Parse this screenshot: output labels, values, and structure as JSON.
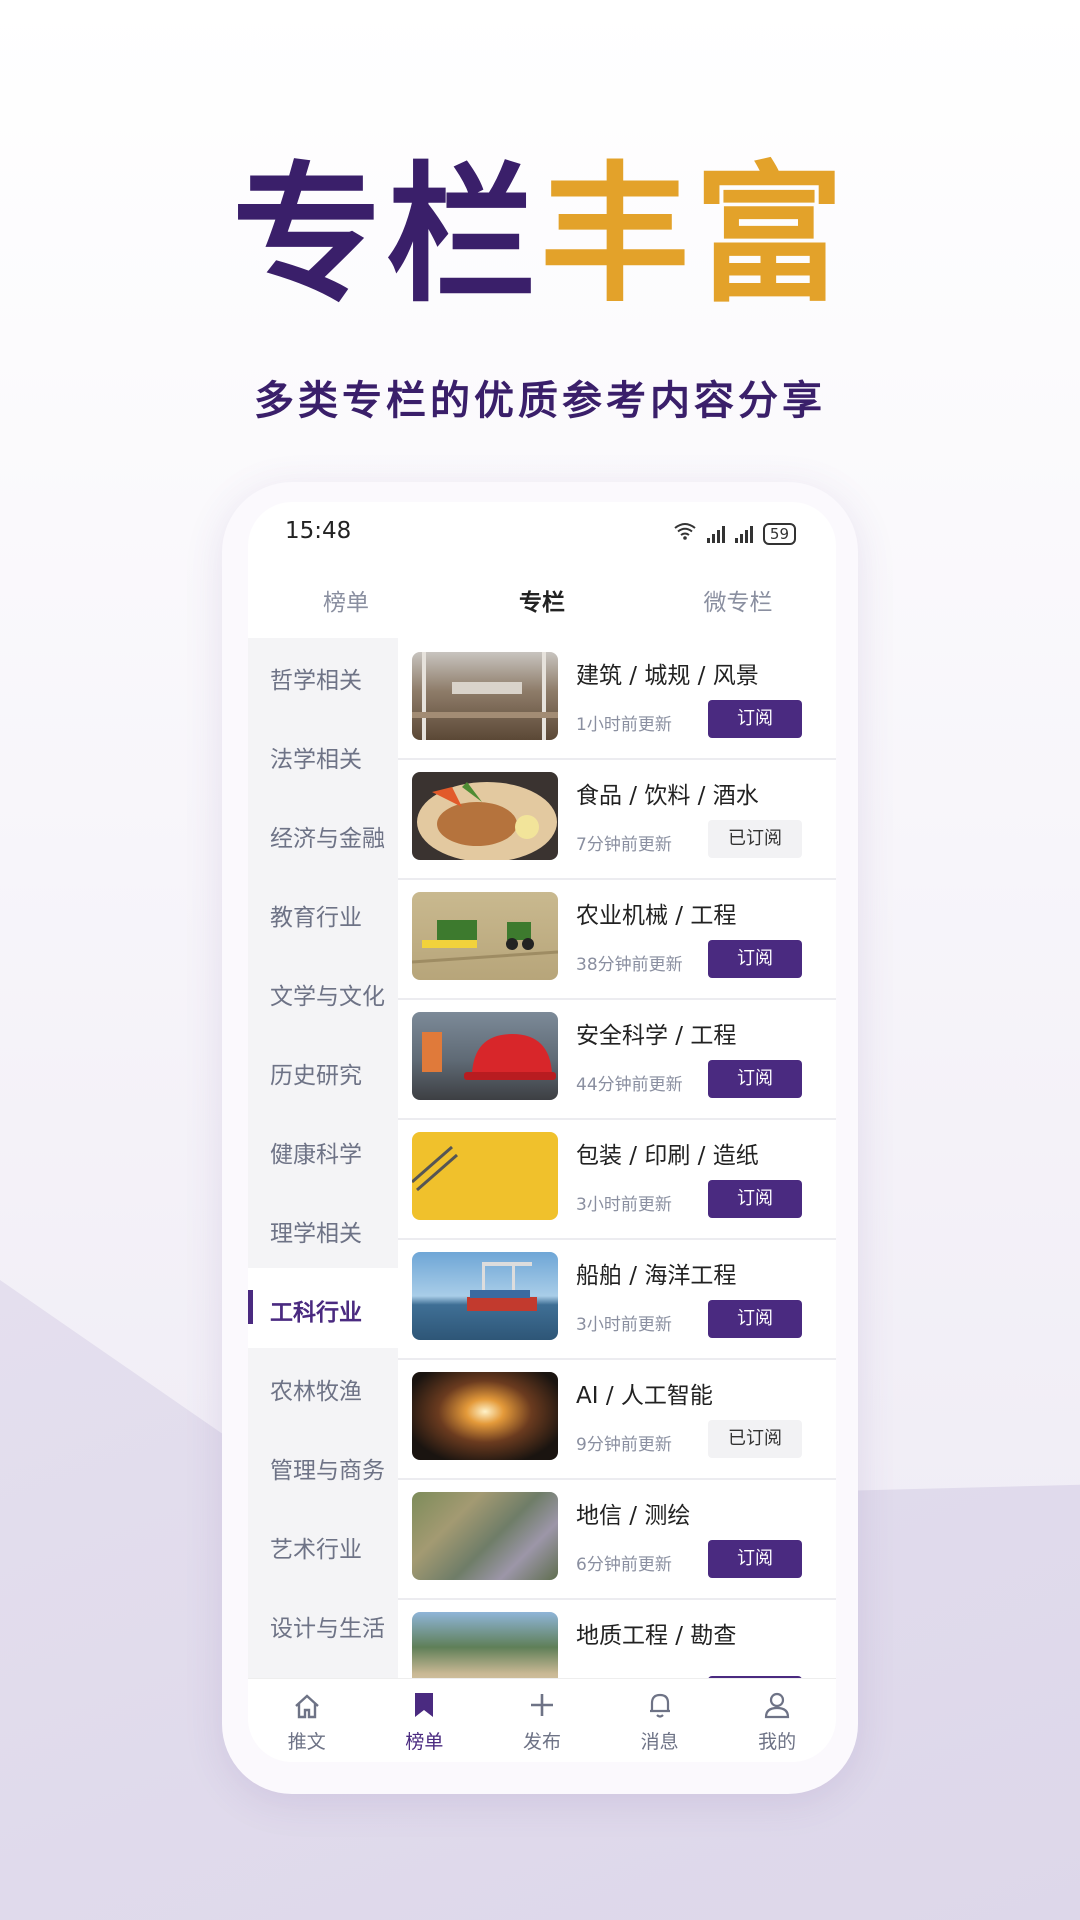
{
  "hero": {
    "title_part1": "专栏",
    "title_part2": "丰富",
    "subtitle": "多类专栏的优质参考内容分享"
  },
  "status": {
    "time": "15:48",
    "battery": "59"
  },
  "tabs": [
    {
      "label": "榜单"
    },
    {
      "label": "专栏",
      "active": true
    },
    {
      "label": "微专栏"
    }
  ],
  "categories": [
    {
      "label": "哲学相关"
    },
    {
      "label": "法学相关"
    },
    {
      "label": "经济与金融"
    },
    {
      "label": "教育行业"
    },
    {
      "label": "文学与文化"
    },
    {
      "label": "历史研究"
    },
    {
      "label": "健康科学"
    },
    {
      "label": "理学相关"
    },
    {
      "label": "工科行业",
      "active": true
    },
    {
      "label": "农林牧渔"
    },
    {
      "label": "管理与商务"
    },
    {
      "label": "艺术行业"
    },
    {
      "label": "设计与生活"
    }
  ],
  "items": [
    {
      "title": "建筑 / 城规 / 风景",
      "time": "1小时前更新",
      "button": "订阅",
      "subscribed": false,
      "thumb": "architecture"
    },
    {
      "title": "食品 / 饮料 / 酒水",
      "time": "7分钟前更新",
      "button": "已订阅",
      "subscribed": true,
      "thumb": "food"
    },
    {
      "title": "农业机械 / 工程",
      "time": "38分钟前更新",
      "button": "订阅",
      "subscribed": false,
      "thumb": "harvester"
    },
    {
      "title": "安全科学 / 工程",
      "time": "44分钟前更新",
      "button": "订阅",
      "subscribed": false,
      "thumb": "helmet"
    },
    {
      "title": "包装 / 印刷 / 造纸",
      "time": "3小时前更新",
      "button": "订阅",
      "subscribed": false,
      "thumb": "yellow-paper"
    },
    {
      "title": "船舶 / 海洋工程",
      "time": "3小时前更新",
      "button": "订阅",
      "subscribed": false,
      "thumb": "ship"
    },
    {
      "title": "AI / 人工智能",
      "time": "9分钟前更新",
      "button": "已订阅",
      "subscribed": true,
      "thumb": "ai-tunnel"
    },
    {
      "title": "地信 / 测绘",
      "time": "6分钟前更新",
      "button": "订阅",
      "subscribed": false,
      "thumb": "satellite-map"
    },
    {
      "title": "地质工程 / 勘查",
      "time": "",
      "button": "",
      "subscribed": false,
      "thumb": "coast"
    }
  ],
  "bottom_nav": [
    {
      "label": "推文",
      "icon": "home-icon"
    },
    {
      "label": "榜单",
      "icon": "bookmark-icon",
      "active": true
    },
    {
      "label": "发布",
      "icon": "plus-icon"
    },
    {
      "label": "消息",
      "icon": "bell-icon"
    },
    {
      "label": "我的",
      "icon": "user-icon"
    }
  ],
  "colors": {
    "primary": "#4a2a80",
    "accent": "#e3a22a"
  }
}
